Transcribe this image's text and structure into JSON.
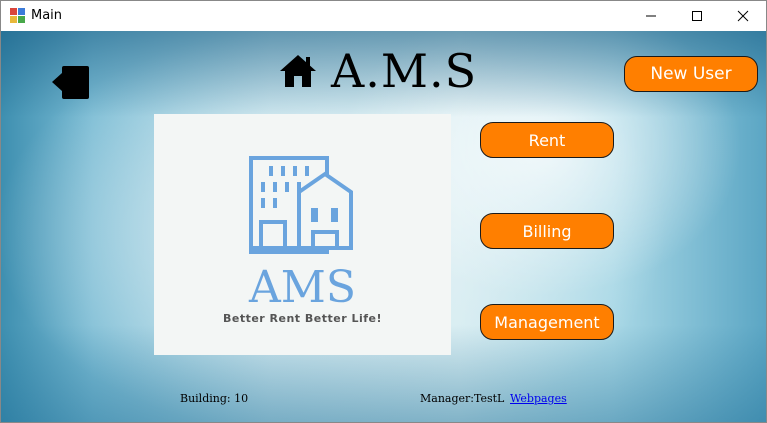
{
  "window": {
    "title": "Main"
  },
  "header": {
    "title": "A.M.S"
  },
  "buttons": {
    "new_user": "New User",
    "rent": "Rent",
    "billing": "Billing",
    "management": "Management"
  },
  "logo": {
    "brand": "AMS",
    "tagline": "Better Rent Better Life!"
  },
  "footer": {
    "building": "Building: 10",
    "manager": "Manager:TestL",
    "link": "Webpages"
  },
  "colors": {
    "accent": "#ff7f00",
    "logo_blue": "#6aa4de"
  },
  "icons": [
    "app-icon",
    "minimize-icon",
    "maximize-icon",
    "close-icon",
    "logout-icon",
    "home-icon",
    "building-icon"
  ]
}
